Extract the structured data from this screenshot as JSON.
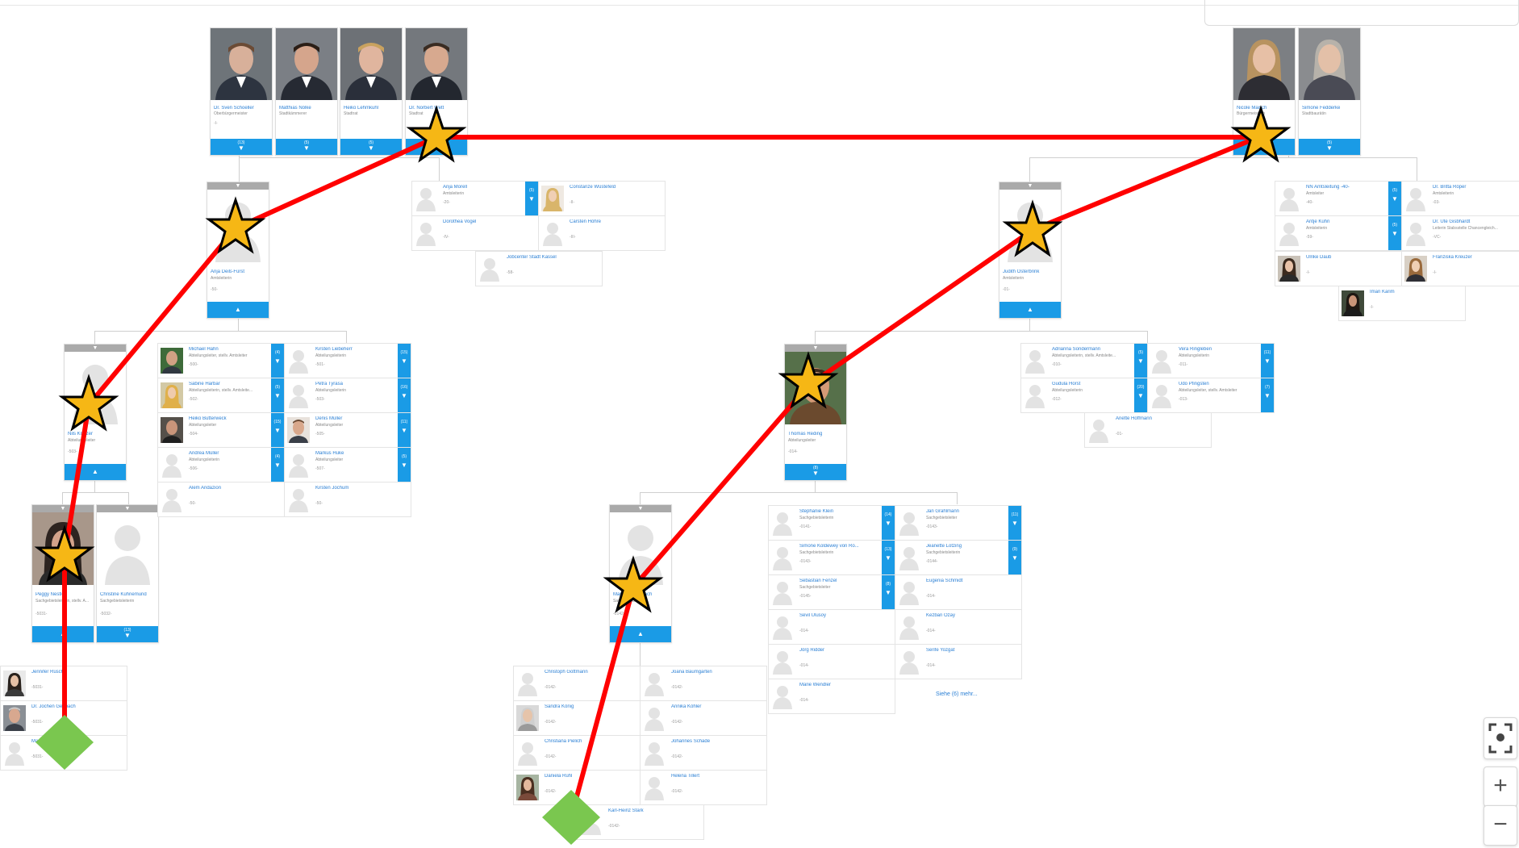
{
  "toolbar": {
    "fit_icon": "fit-screen-icon",
    "zoom_in_label": "+",
    "zoom_out_label": "−"
  },
  "colors": {
    "accent": "#1a9be6",
    "link": "#2a7fd4",
    "path": "#ff0000",
    "star": "#f6b715",
    "end_marker": "#7ac74f"
  },
  "top_left_group": [
    {
      "name": "Dr. Sven Schoeller",
      "role": "Oberbürgermeister",
      "dash": "-I-",
      "count": "(13)"
    },
    {
      "name": "Matthias Nölke",
      "role": "Stadtkämmerer",
      "dash": "",
      "count": "(5)"
    },
    {
      "name": "Heiko Lehmkuhl",
      "role": "Stadtrat",
      "dash": "",
      "count": "(5)"
    },
    {
      "name": "Dr. Norbert Wett",
      "role": "Stadtrat",
      "dash": "",
      "count": "(5)"
    }
  ],
  "top_right_group": [
    {
      "name": "Nicole Maisch",
      "role": "Bürgermeisterin",
      "dash": "",
      "count": "(5)"
    },
    {
      "name": "Simone Fedderke",
      "role": "Stadtbaurätin",
      "dash": "",
      "count": "(5)"
    }
  ],
  "branch_cards": [
    {
      "name": "Anja Deiß-Fürst",
      "role": "Amtsleiterin",
      "dash": "-50-",
      "type": "up"
    },
    {
      "name": "Judith Osterbrink",
      "role": "Amtsleiterin",
      "dash": "-01-",
      "type": "up"
    },
    {
      "name": "Nils Kratzer",
      "role": "Abteilungsleiter",
      "dash": "-503-",
      "type": "up"
    },
    {
      "name": "Thomas Reding",
      "role": "Abteilungsleiter",
      "dash": "-014-",
      "count": "(8)",
      "type": "count"
    },
    {
      "name": "Peggy Nestler",
      "role": "Sachgebietsleiterin, stellv. A...",
      "dash": "-5031-",
      "type": "up"
    },
    {
      "name": "Christine Kühnemund",
      "role": "Sachgebietsleiterin",
      "dash": "-5032-",
      "count": "(13)",
      "type": "count"
    },
    {
      "name": "Marco Lauterbach",
      "role": "Sachgebietsleiter",
      "dash": "-0142-",
      "type": "up"
    }
  ],
  "staff_cells": [
    {
      "name": "Anja Morell",
      "role": "Amtsleiterin",
      "dash": "-20-",
      "count": "(5)"
    },
    {
      "name": "Constanze Wüstefeld",
      "role": "",
      "dash": "-II-"
    },
    {
      "name": "Dorothea Vogel",
      "role": "",
      "dash": "-IV-"
    },
    {
      "name": "Carsten Höhre",
      "role": "",
      "dash": "-III-"
    },
    {
      "name": "Jobcenter Stadt Kassel",
      "role": "",
      "dash": "-58-"
    },
    {
      "name": "NN Amtsleitung -40-",
      "role": "Amtsleiter",
      "dash": "-40-",
      "count": "(5)"
    },
    {
      "name": "Dr. Britta Röper",
      "role": "Amtsleiterin",
      "dash": "-03-",
      "count": ""
    },
    {
      "name": "Antje Kühn",
      "role": "Amtsleiterin",
      "dash": "-59-",
      "count": "(5)"
    },
    {
      "name": "Dr. Ute Gisbhardt",
      "role": "Leiterin Stabsstelle Chancengleich...",
      "dash": "-VC-",
      "count": ""
    },
    {
      "name": "Ulrike Daub",
      "role": "",
      "dash": "-I-"
    },
    {
      "name": "Franziska Kreuzer",
      "role": "",
      "dash": "-I-"
    },
    {
      "name": "Iman Karim",
      "role": "",
      "dash": "-I-"
    },
    {
      "name": "Michael Hahn",
      "role": "Abteilungsleiter, stellv. Amtsleiter",
      "dash": "-500-",
      "count": "(4)"
    },
    {
      "name": "Kirsten Liebeherr",
      "role": "Abteilungsleiterin",
      "dash": "-501-",
      "count": "(15)"
    },
    {
      "name": "Sabine Harbar",
      "role": "Abteilungsleiterin, stellv. Amtsleite...",
      "dash": "-502-",
      "count": "(5)"
    },
    {
      "name": "Petra Tyrasa",
      "role": "Abteilungsleiterin",
      "dash": "-503-",
      "count": "(16)"
    },
    {
      "name": "Heiko Butterweck",
      "role": "Abteilungsleiter",
      "dash": "-504-",
      "count": "(15)"
    },
    {
      "name": "Denis Müller",
      "role": "Abteilungsleiter",
      "dash": "-505-",
      "count": "(11)"
    },
    {
      "name": "Andrea Müller",
      "role": "Abteilungsleiterin",
      "dash": "-506-",
      "count": "(4)"
    },
    {
      "name": "Markus Huke",
      "role": "Abteilungsleiter",
      "dash": "-507-",
      "count": "(5)"
    },
    {
      "name": "Alem Andazion",
      "role": "",
      "dash": "-50-"
    },
    {
      "name": "Kirsten Jochum",
      "role": "",
      "dash": "-50-"
    },
    {
      "name": "Adrianna Sondermann",
      "role": "Abteilungsleiterin, stellv. Amtsleite...",
      "dash": "-010-",
      "count": "(5)"
    },
    {
      "name": "Vera Ringleben",
      "role": "Abteilungsleiterin",
      "dash": "-011-",
      "count": "(11)"
    },
    {
      "name": "Gudula Horst",
      "role": "Abteilungsleiterin",
      "dash": "-012-",
      "count": "(20)"
    },
    {
      "name": "Udo Pfingsten",
      "role": "Abteilungsleiter, stellv. Amtsleiter",
      "dash": "-013-",
      "count": "(7)"
    },
    {
      "name": "Anette Hoffmann",
      "role": "",
      "dash": "-01-"
    },
    {
      "name": "Stephanie Klein",
      "role": "Sachgebietsleiterin",
      "dash": "-0141-",
      "count": "(14)"
    },
    {
      "name": "Jan Grahlmann",
      "role": "Sachgebietsleiter",
      "dash": "-0143-",
      "count": "(11)"
    },
    {
      "name": "Simone Koldewey von Ro...",
      "role": "Sachgebietsleiterin",
      "dash": "-0143-",
      "count": "(13)"
    },
    {
      "name": "Jeanette Lotzing",
      "role": "Sachgebietsleiterin",
      "dash": "-0144-",
      "count": "(9)"
    },
    {
      "name": "Sebastian Fenzel",
      "role": "Sachgebietsleiter",
      "dash": "-0145-",
      "count": "(8)"
    },
    {
      "name": "Eugenia Schmidt",
      "role": "",
      "dash": "-014-"
    },
    {
      "name": "Sevil Ulusoy",
      "role": "",
      "dash": "-014-"
    },
    {
      "name": "Kezban Ozay",
      "role": "",
      "dash": "-014-"
    },
    {
      "name": "Jörg Ridder",
      "role": "",
      "dash": "-014-"
    },
    {
      "name": "Serife Yozgat",
      "role": "",
      "dash": "-014-"
    },
    {
      "name": "Marie Wendler",
      "role": "",
      "dash": "-014-"
    },
    {
      "name": "Jennifer Rüsch",
      "role": "",
      "dash": "-5031-"
    },
    {
      "name": "Dr. Jochen Gebbach",
      "role": "",
      "dash": "-5031-"
    },
    {
      "name": "Manuela Zimmer",
      "role": "",
      "dash": "-5031-"
    },
    {
      "name": "Christoph Gottmann",
      "role": "",
      "dash": "-0142-"
    },
    {
      "name": "Joana Baumgarten",
      "role": "",
      "dash": "-0142-"
    },
    {
      "name": "Sandra König",
      "role": "",
      "dash": "-0142-"
    },
    {
      "name": "Annika Köhler",
      "role": "",
      "dash": "-0142-"
    },
    {
      "name": "Christiana Pielich",
      "role": "",
      "dash": "-0142-"
    },
    {
      "name": "Johannes Schade",
      "role": "",
      "dash": "-0142-"
    },
    {
      "name": "Daniela Rühl",
      "role": "",
      "dash": "-0142-"
    },
    {
      "name": "Helena Tillert",
      "role": "",
      "dash": "-0142-"
    },
    {
      "name": "Karl-Heinz Stark",
      "role": "",
      "dash": "-0142-"
    }
  ],
  "more_link": "Siehe (6) mehr..."
}
